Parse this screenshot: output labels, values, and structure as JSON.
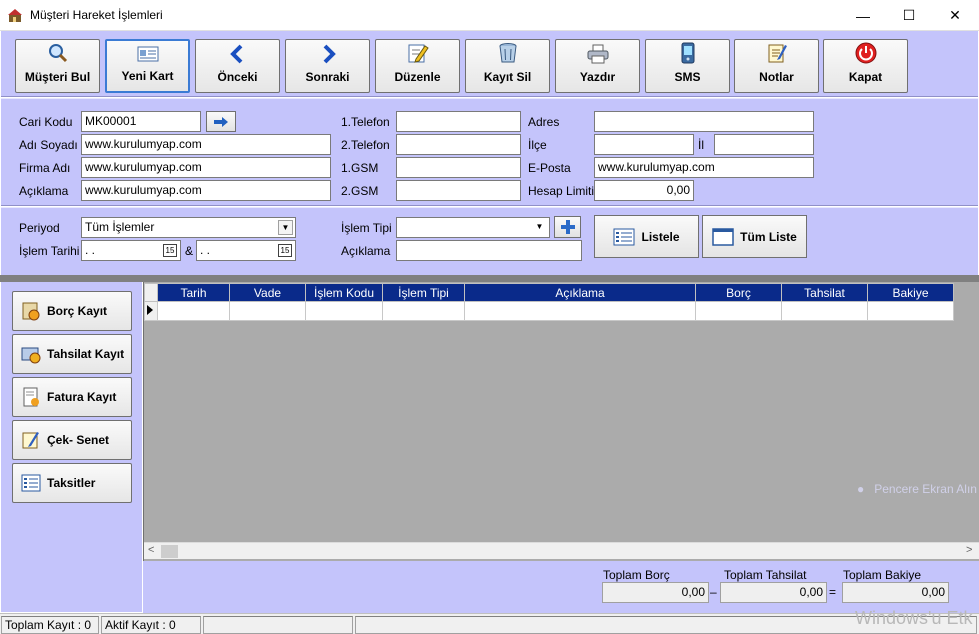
{
  "window": {
    "title": "Müşteri Hareket İşlemleri",
    "minimize": "—",
    "maximize": "☐",
    "close": "✕"
  },
  "toolbar": {
    "buttons": [
      {
        "label": "Müşteri Bul",
        "icon": "magnifier-icon"
      },
      {
        "label": "Yeni Kart",
        "icon": "card-icon"
      },
      {
        "label": "Önceki",
        "icon": "arrow-left-icon"
      },
      {
        "label": "Sonraki",
        "icon": "arrow-right-icon"
      },
      {
        "label": "Düzenle",
        "icon": "edit-icon"
      },
      {
        "label": "Kayıt Sil",
        "icon": "trash-icon"
      },
      {
        "label": "Yazdır",
        "icon": "printer-icon"
      },
      {
        "label": "SMS",
        "icon": "phone-icon"
      },
      {
        "label": "Notlar",
        "icon": "notes-icon"
      },
      {
        "label": "Kapat",
        "icon": "power-icon"
      }
    ]
  },
  "info": {
    "cari_kodu_label": "Cari Kodu",
    "cari_kodu_value": "MK00001",
    "adi_soyadi_label": "Adı Soyadı",
    "adi_soyadi_value": "www.kurulumyap.com",
    "firma_adi_label": "Firma Adı",
    "firma_adi_value": "www.kurulumyap.com",
    "aciklama_label": "Açıklama",
    "aciklama_value": "www.kurulumyap.com",
    "telefon1_label": "1.Telefon",
    "telefon1_value": "",
    "telefon2_label": "2.Telefon",
    "telefon2_value": "",
    "gsm1_label": "1.GSM",
    "gsm1_value": "",
    "gsm2_label": "2.GSM",
    "gsm2_value": "",
    "adres_label": "Adres",
    "adres_value": "",
    "ilce_label": "İlçe",
    "ilce_value": "",
    "il_label": "İl",
    "il_value": "",
    "eposta_label": "E-Posta",
    "eposta_value": "www.kurulumyap.com",
    "hesap_limiti_label": "Hesap Limiti",
    "hesap_limiti_value": "0,00"
  },
  "filter": {
    "periyod_label": "Periyod",
    "periyod_value": "Tüm İşlemler",
    "islem_tarihi_label": "İşlem Tarihi",
    "date_from": " .  .",
    "date_to": " .  .",
    "amp": "&",
    "islem_tipi_label": "İşlem Tipi",
    "islem_tipi_value": "",
    "aciklama_label": "Açıklama",
    "aciklama_value": "",
    "listele_label": "Listele",
    "tum_liste_label": "Tüm Liste"
  },
  "left_buttons": [
    {
      "label": "Borç Kayıt",
      "icon": "debt-icon"
    },
    {
      "label": "Tahsilat Kayıt",
      "icon": "collection-icon"
    },
    {
      "label": "Fatura Kayıt",
      "icon": "invoice-icon"
    },
    {
      "label": "Çek- Senet",
      "icon": "cheque-icon"
    },
    {
      "label": "Taksitler",
      "icon": "list-icon"
    }
  ],
  "grid": {
    "columns": [
      "Tarih",
      "Vade",
      "İşlem Kodu",
      "İşlem Tipi",
      "Açıklama",
      "Borç",
      "Tahsilat",
      "Bakiye"
    ],
    "rows": [
      [
        "",
        "",
        "",
        "",
        "",
        "",
        "",
        ""
      ]
    ]
  },
  "totals": {
    "borc_label": "Toplam Borç",
    "borc_value": "0,00",
    "tahsilat_label": "Toplam Tahsilat",
    "tahsilat_value": "0,00",
    "bakiye_label": "Toplam Bakiye",
    "bakiye_value": "0,00",
    "minus": "–",
    "equals": "="
  },
  "status": {
    "toplam_kayit": "Toplam Kayıt : 0",
    "aktif_kayit": "Aktif Kayıt : 0"
  },
  "overlay": {
    "toast": "Pencere Ekran Alın",
    "watermark": "Windows'u Etk"
  },
  "colors": {
    "panel": "#c4c4fb",
    "grid_header": "#0a2a8a"
  }
}
